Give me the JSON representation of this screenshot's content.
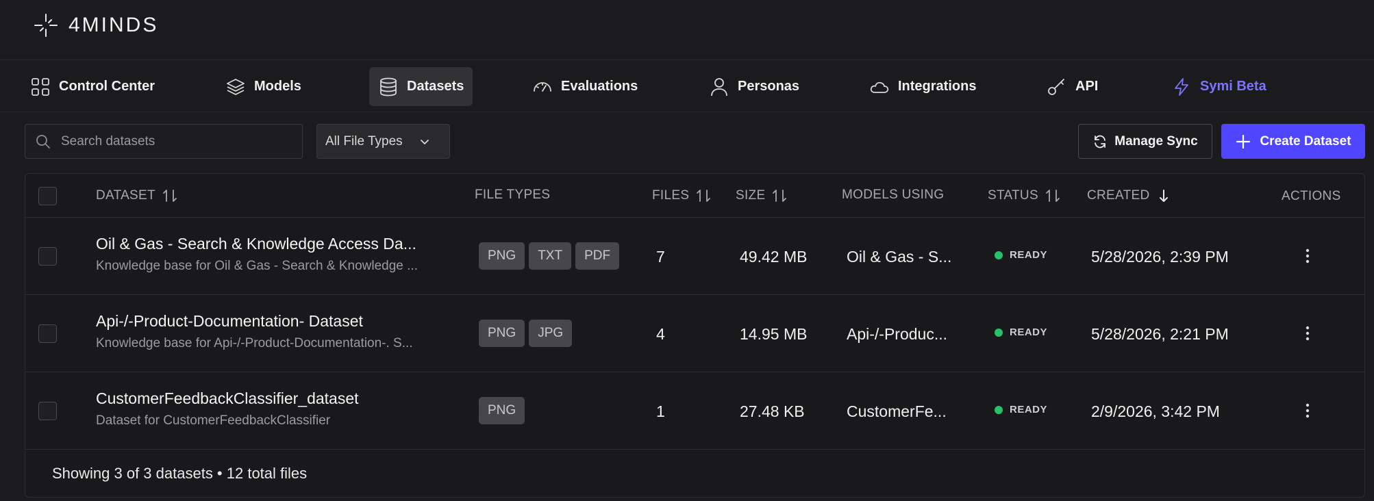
{
  "app": {
    "brand": "4MINDS"
  },
  "nav": [
    {
      "label": "Control Center",
      "icon": "grid-icon"
    },
    {
      "label": "Models",
      "icon": "layers-icon"
    },
    {
      "label": "Datasets",
      "icon": "database-icon"
    },
    {
      "label": "Evaluations",
      "icon": "gauge-icon"
    },
    {
      "label": "Personas",
      "icon": "user-icon"
    },
    {
      "label": "Integrations",
      "icon": "cloud-icon"
    },
    {
      "label": "API",
      "icon": "key-icon"
    },
    {
      "label": "Symi Beta",
      "icon": "bolt-icon"
    }
  ],
  "toolbar": {
    "search_placeholder": "Search datasets",
    "filter_value": "All File Types",
    "manage_sync_label": "Manage Sync",
    "create_label": "Create Dataset"
  },
  "table": {
    "headers": {
      "dataset": "DATASET",
      "file_types": "FILE TYPES",
      "files": "FILES",
      "size": "SIZE",
      "models_using": "MODELS USING",
      "status": "STATUS",
      "created": "CREATED",
      "actions": "ACTIONS"
    },
    "rows": [
      {
        "name": "Oil & Gas - Search & Knowledge Access Da...",
        "description": "Knowledge base for Oil & Gas - Search & Knowledge ...",
        "file_types": [
          "PNG",
          "TXT",
          "PDF"
        ],
        "files": "7",
        "size": "49.42 MB",
        "models_using": "Oil & Gas - S...",
        "status": "READY",
        "created": "5/28/2026, 2:39 PM"
      },
      {
        "name": "Api-/-Product-Documentation- Dataset",
        "description": "Knowledge base for Api-/-Product-Documentation-. S...",
        "file_types": [
          "PNG",
          "JPG"
        ],
        "files": "4",
        "size": "14.95 MB",
        "models_using": "Api-/-Produc...",
        "status": "READY",
        "created": "5/28/2026, 2:21 PM"
      },
      {
        "name": "CustomerFeedbackClassifier_dataset",
        "description": "Dataset for CustomerFeedbackClassifier",
        "file_types": [
          "PNG"
        ],
        "files": "1",
        "size": "27.48 KB",
        "models_using": "CustomerFe...",
        "status": "READY",
        "created": "2/9/2026, 3:42 PM"
      }
    ],
    "footer": "Showing 3 of 3 datasets • 12 total files"
  },
  "colors": {
    "accent": "#5046ff",
    "symi": "#7a74ff",
    "ready": "#27c16a"
  }
}
